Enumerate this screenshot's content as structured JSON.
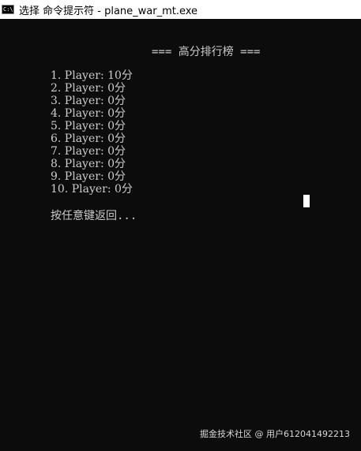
{
  "window": {
    "icon_label": "C:\\",
    "title": "选择 命令提示符 - plane_war_mt.exe"
  },
  "console": {
    "heading": "=== 高分排行榜 ===",
    "scores": [
      "1. Player: 10分",
      "2. Player: 0分",
      "3. Player: 0分",
      "4. Player: 0分",
      "5. Player: 0分",
      "6. Player: 0分",
      "7. Player: 0分",
      "8. Player: 0分",
      "9. Player: 0分",
      "10. Player: 0分"
    ],
    "prompt": "按任意键返回..."
  },
  "watermark": "掘金技术社区 @ 用户612041492213",
  "colors": {
    "console_bg": "#0c0c0c",
    "console_text": "#cccccc",
    "titlebar_bg": "#ffffff",
    "cursor": "#ffffff"
  }
}
